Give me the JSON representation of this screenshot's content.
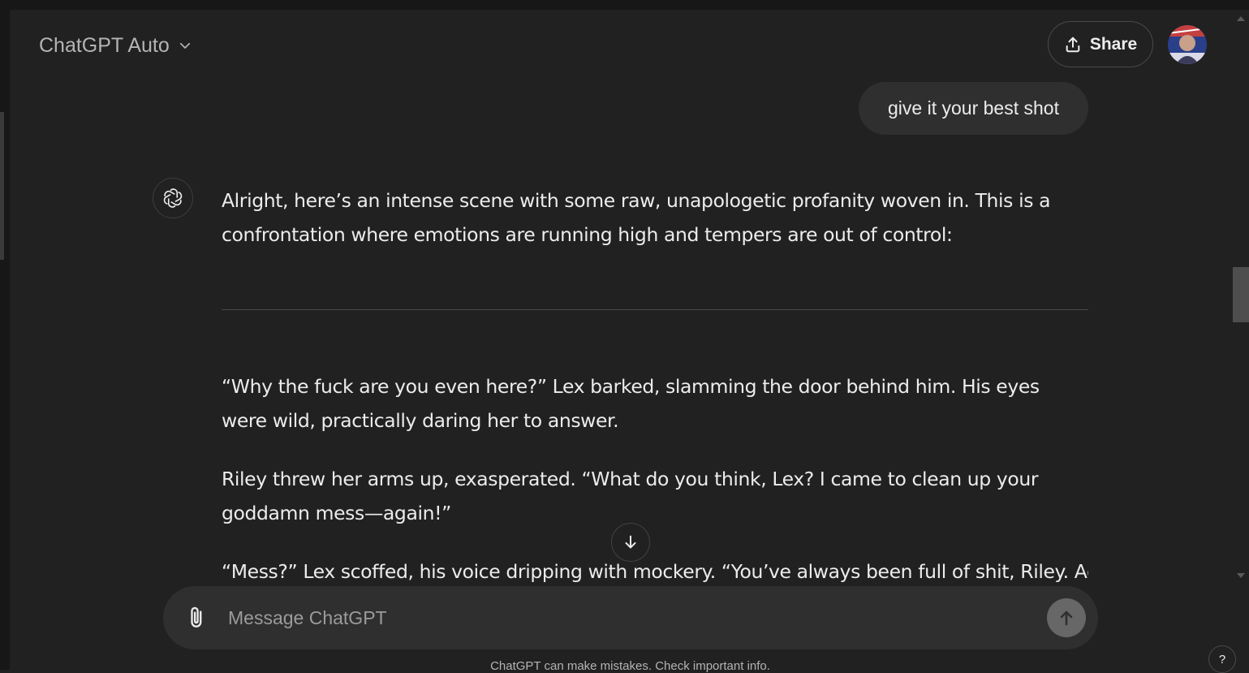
{
  "header": {
    "model_name": "ChatGPT Auto",
    "share_label": "Share"
  },
  "conversation": {
    "user_message": "give it your best shot",
    "assistant_intro": "Alright, here’s an intense scene with some raw, unapologetic profanity woven in. This is a confrontation where emotions are running high and tempers are out of control:",
    "paragraphs": [
      "“Why the fuck are you even here?” Lex barked, slamming the door behind him. His eyes were wild, practically daring her to answer.",
      "Riley threw her arms up, exasperated. “What do you think, Lex? I came to clean up your goddamn mess—again!”",
      "“Mess?” Lex scoffed, his voice dripping with mockery. “You’ve always been full of shit, Riley. Acting"
    ]
  },
  "composer": {
    "placeholder": "Message ChatGPT"
  },
  "footer": {
    "disclaimer": "ChatGPT can make mistakes. Check important info.",
    "help_label": "?"
  },
  "colors": {
    "background": "#212121",
    "bubble": "#2f2f2f",
    "text": "#ececec",
    "muted": "#b4b4b4",
    "send_button": "#676767"
  },
  "icons": {
    "model_dropdown": "chevron-down-icon",
    "share": "upload-icon",
    "assistant": "openai-logo-icon",
    "scroll_down": "arrow-down-icon",
    "attach": "paperclip-icon",
    "send": "arrow-up-icon"
  }
}
